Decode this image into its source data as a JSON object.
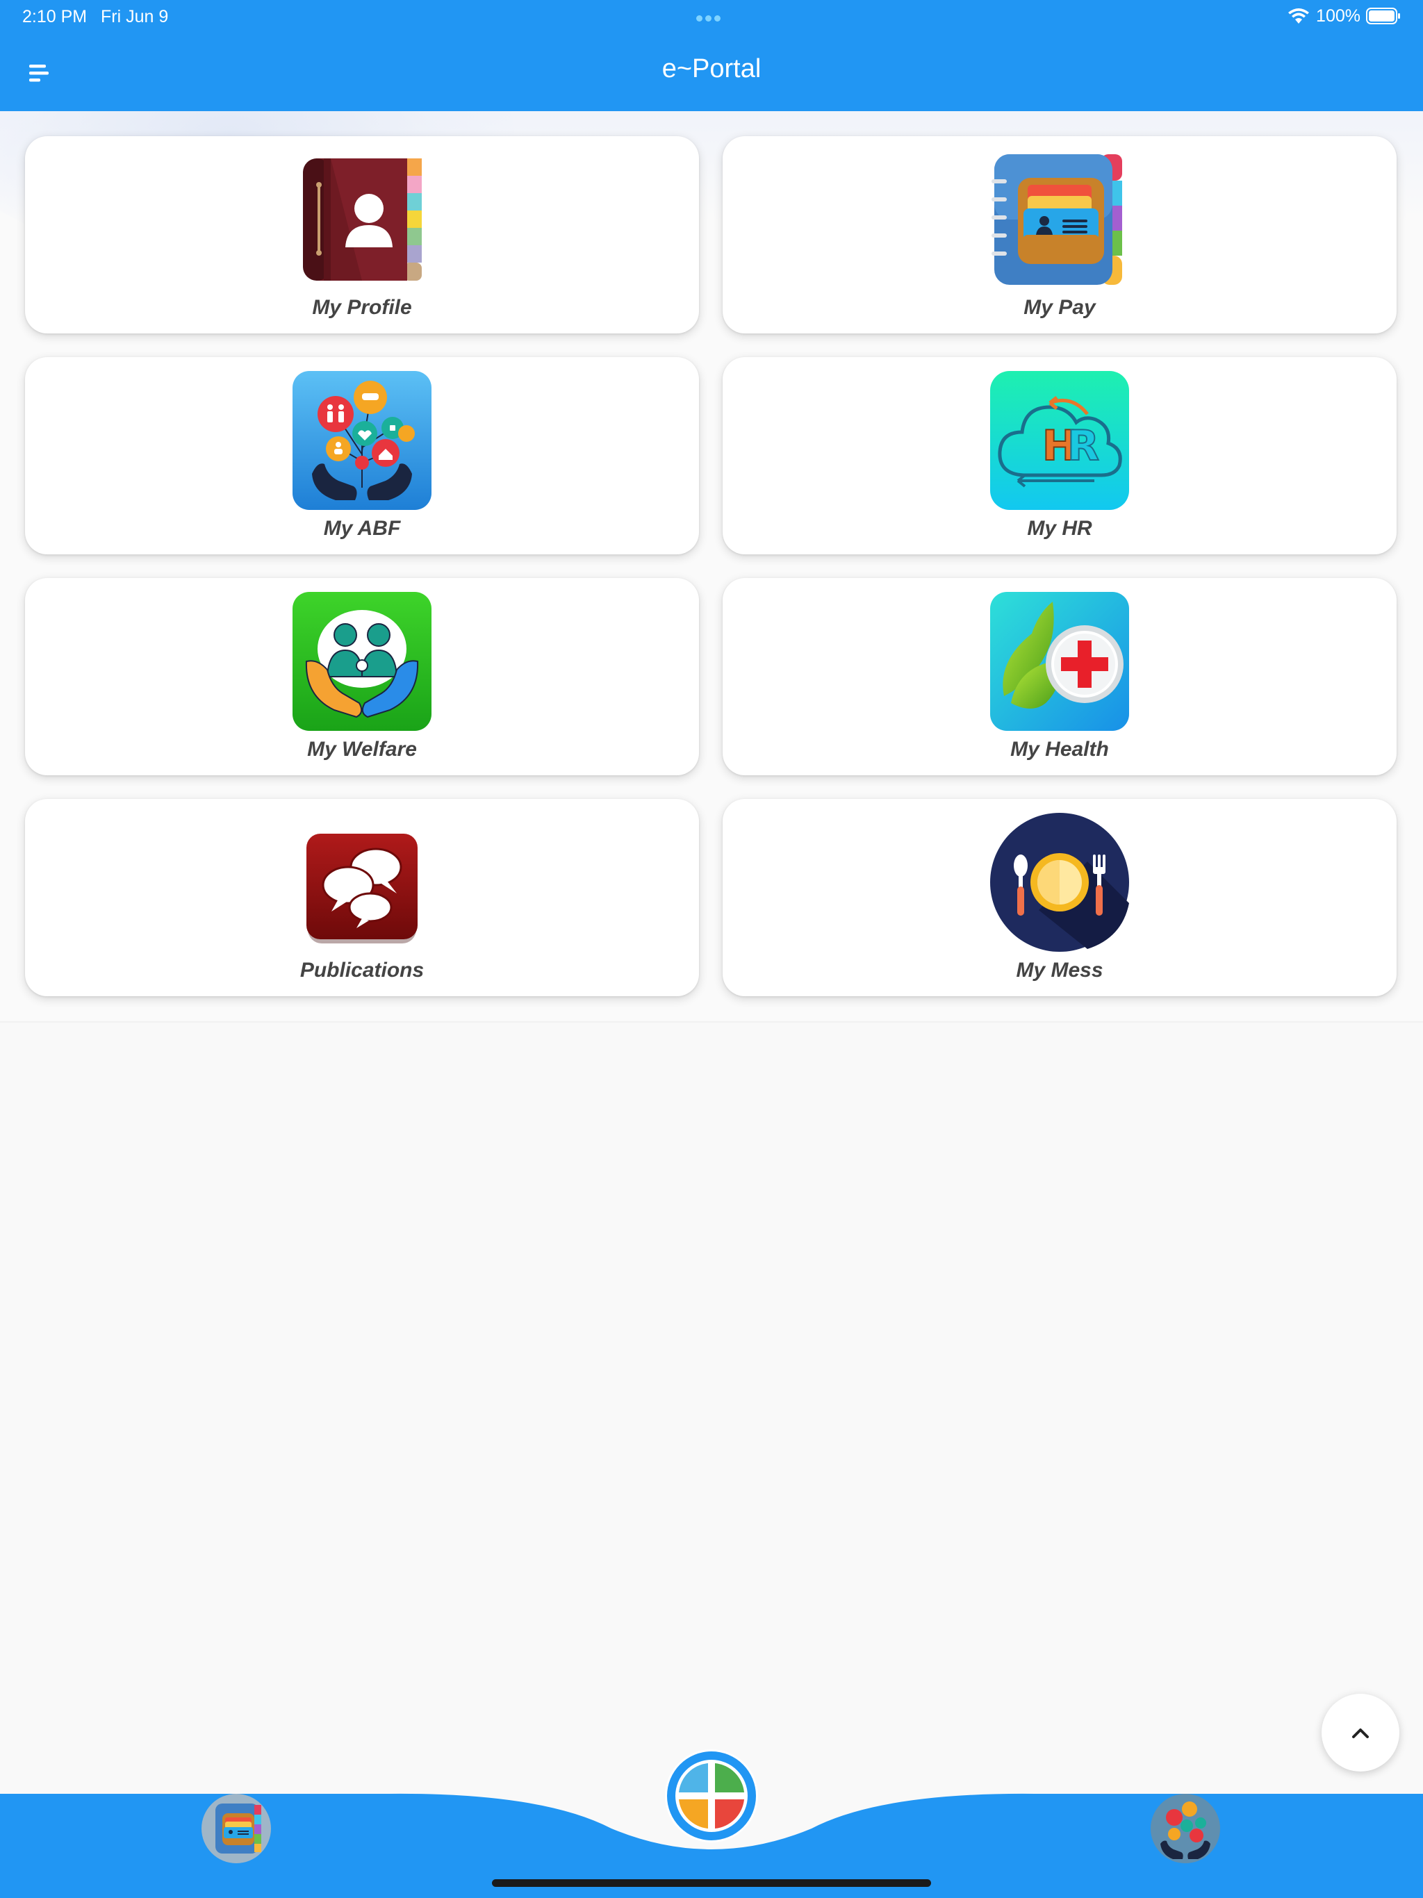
{
  "status_bar": {
    "time": "2:10 PM",
    "date": "Fri Jun 9",
    "battery": "100%"
  },
  "header": {
    "title": "e~Portal",
    "menu_icon": "menu-icon"
  },
  "tiles": [
    {
      "label": "My Profile",
      "icon": "profile-book-icon"
    },
    {
      "label": "My Pay",
      "icon": "pay-wallet-icon"
    },
    {
      "label": "My ABF",
      "icon": "abf-hands-icon"
    },
    {
      "label": "My HR",
      "icon": "hr-cloud-icon"
    },
    {
      "label": "My Welfare",
      "icon": "welfare-family-icon"
    },
    {
      "label": "My Health",
      "icon": "health-cross-icon"
    },
    {
      "label": "Publications",
      "icon": "publications-chat-icon"
    },
    {
      "label": "My Mess",
      "icon": "mess-plate-icon"
    }
  ],
  "bottom_nav": {
    "left_icon": "pay-wallet-icon",
    "center_icon": "home-grid-icon",
    "right_icon": "abf-hands-icon"
  },
  "scroll_top_icon": "chevron-up-icon",
  "colors": {
    "primary": "#2196f3",
    "background": "#f9f9f9",
    "card": "#ffffff",
    "label": "#444444"
  }
}
